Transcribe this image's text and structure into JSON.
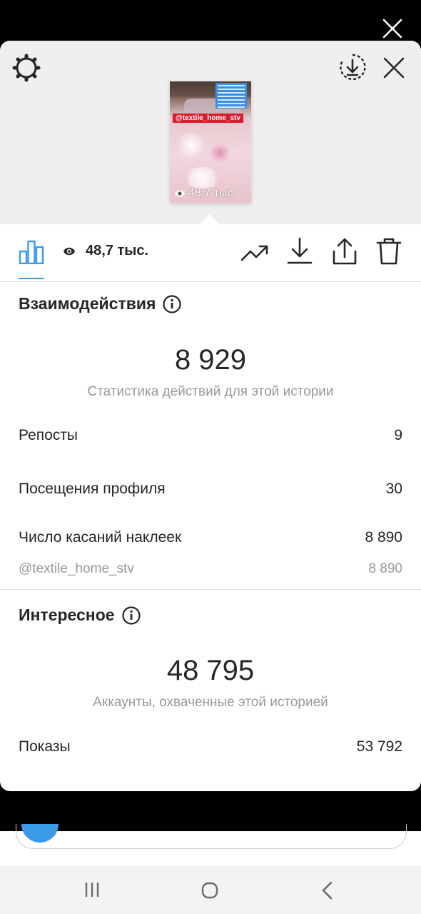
{
  "thumbnail": {
    "tag": "@textile_home_stv",
    "views": "48,7 тыс."
  },
  "toolbar": {
    "views": "48,7 тыс."
  },
  "interactions": {
    "title": "Взаимодействия",
    "total": "8 929",
    "subtitle": "Статистика действий для этой истории",
    "rows": [
      {
        "label": "Репосты",
        "value": "9"
      },
      {
        "label": "Посещения профиля",
        "value": "30"
      },
      {
        "label": "Число касаний наклеек",
        "value": "8 890"
      }
    ],
    "sticker": {
      "label": "@textile_home_stv",
      "value": "8 890"
    }
  },
  "discovery": {
    "title": "Интересное",
    "total": "48 795",
    "subtitle": "Аккаунты, охваченные этой историей",
    "rows": [
      {
        "label": "Показы",
        "value": "53 792"
      }
    ]
  },
  "colors": {
    "accent": "#3b9ae8",
    "text": "#262626",
    "muted": "#999999",
    "header_bg": "#efefef"
  },
  "icons": [
    "close-icon",
    "gear-icon",
    "download-circle-icon",
    "bar-chart-icon",
    "eye-icon",
    "trending-icon",
    "download-icon",
    "share-icon",
    "trash-icon",
    "info-icon",
    "recent-apps-icon",
    "home-icon",
    "back-icon"
  ]
}
